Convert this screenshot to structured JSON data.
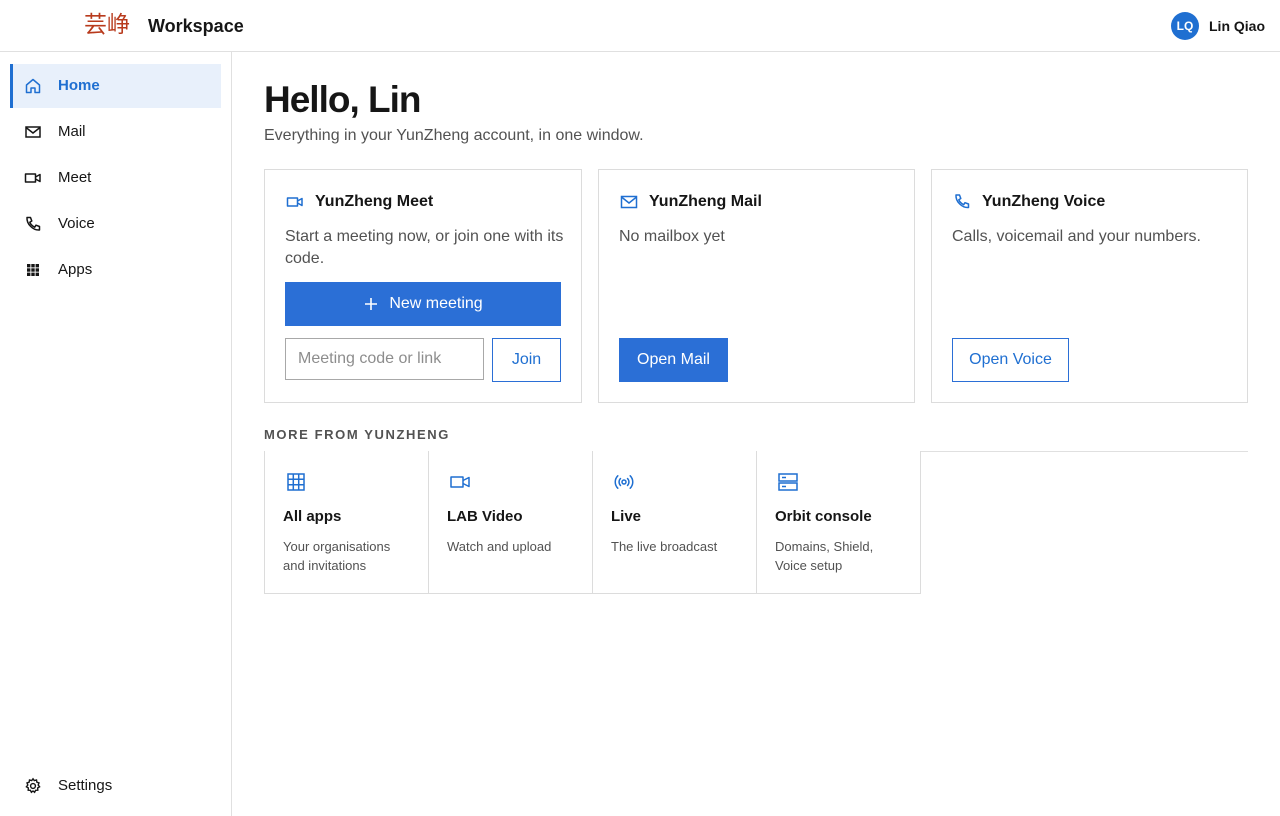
{
  "header": {
    "logo_text": "芸峥",
    "app_name": "Workspace",
    "user_initials": "LQ",
    "user_name": "Lin Qiao"
  },
  "sidebar": {
    "items": [
      {
        "label": "Home",
        "icon": "home-icon",
        "active": true
      },
      {
        "label": "Mail",
        "icon": "mail-icon",
        "active": false
      },
      {
        "label": "Meet",
        "icon": "video-icon",
        "active": false
      },
      {
        "label": "Voice",
        "icon": "phone-icon",
        "active": false
      },
      {
        "label": "Apps",
        "icon": "grid-icon",
        "active": false
      }
    ],
    "settings": {
      "label": "Settings",
      "icon": "gear-icon"
    }
  },
  "main": {
    "greeting": "Hello, Lin",
    "subtitle": "Everything in your YunZheng account, in one window.",
    "cards": {
      "meet": {
        "title": "YunZheng Meet",
        "icon": "video-icon",
        "description": "Start a meeting now, or join one with its code.",
        "new_meeting_label": "New meeting",
        "code_placeholder": "Meeting code or link",
        "code_value": "",
        "join_label": "Join"
      },
      "mail": {
        "title": "YunZheng Mail",
        "icon": "mail-icon",
        "description": "No mailbox yet",
        "button_label": "Open Mail"
      },
      "voice": {
        "title": "YunZheng Voice",
        "icon": "phone-icon",
        "description": "Calls, voicemail and your numbers.",
        "button_label": "Open Voice"
      }
    },
    "more": {
      "heading": "MORE FROM YUNZHENG",
      "tiles": [
        {
          "title": "All apps",
          "description": "Your organisations and invitations",
          "icon": "grid-icon"
        },
        {
          "title": "LAB Video",
          "description": "Watch and upload",
          "icon": "video-icon"
        },
        {
          "title": "Live",
          "description": "The live broadcast",
          "icon": "broadcast-icon"
        },
        {
          "title": "Orbit console",
          "description": "Domains, Shield, Voice setup",
          "icon": "server-icon"
        }
      ]
    }
  },
  "colors": {
    "accent": "#1f6fd1",
    "button": "#2b6fd6",
    "logo": "#b83a1c",
    "active_bg": "#e8f0fb",
    "border": "#dcdcdc"
  }
}
